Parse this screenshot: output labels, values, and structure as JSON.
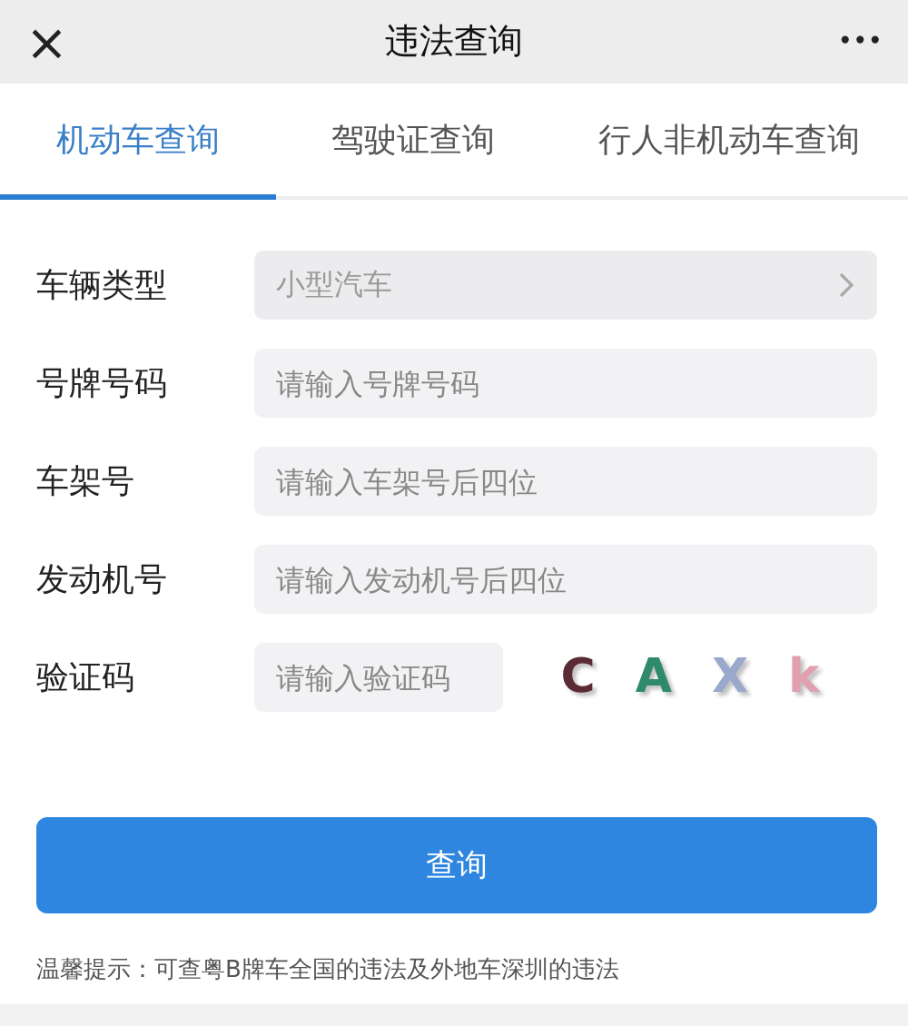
{
  "header": {
    "close": "×",
    "title": "违法查询",
    "more": "•••"
  },
  "tabs": [
    {
      "label": "机动车查询",
      "selected": true
    },
    {
      "label": "驾驶证查询",
      "selected": false
    },
    {
      "label": "行人非机动车查询",
      "selected": false
    }
  ],
  "form": [
    {
      "label": "车辆类型",
      "kind": "select",
      "value": "小型汽车"
    },
    {
      "label": "号牌号码",
      "kind": "input",
      "placeholder": "请输入号牌号码"
    },
    {
      "label": "车架号",
      "kind": "input",
      "placeholder": "请输入车架号后四位"
    },
    {
      "label": "发动机号",
      "kind": "input",
      "placeholder": "请输入发动机号后四位"
    },
    {
      "label": "验证码",
      "kind": "captcha",
      "placeholder": "请输入验证码"
    }
  ],
  "captcha": [
    {
      "char": "C",
      "color": "#5a2a35"
    },
    {
      "char": "A",
      "color": "#2e8a6a"
    },
    {
      "char": "X",
      "color": "#9aa8cc"
    },
    {
      "char": "k",
      "color": "#e0a0b0"
    }
  ],
  "submit": "查询",
  "hint": "温馨提示：可查粤B牌车全国的违法及外地车深圳的违法"
}
